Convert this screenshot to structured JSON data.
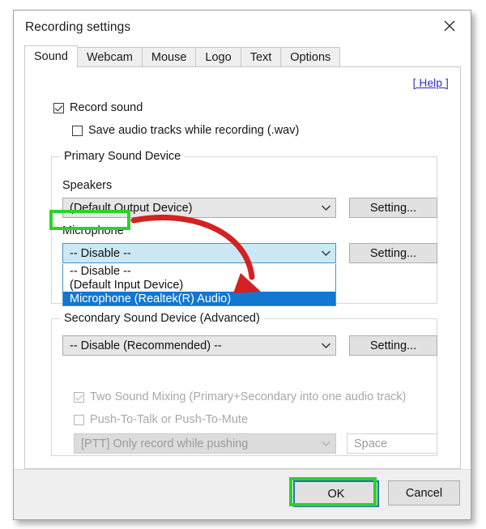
{
  "window": {
    "title": "Recording settings",
    "close_icon": "close-icon"
  },
  "tabs": [
    {
      "label": "Sound",
      "active": true
    },
    {
      "label": "Webcam",
      "active": false
    },
    {
      "label": "Mouse",
      "active": false
    },
    {
      "label": "Logo",
      "active": false
    },
    {
      "label": "Text",
      "active": false
    },
    {
      "label": "Options",
      "active": false
    }
  ],
  "content": {
    "record_sound": {
      "label": "Record sound",
      "checked": true
    },
    "save_audio_tracks": {
      "label": "Save audio tracks while recording (.wav)",
      "checked": false
    },
    "help_link": "[ Help ]",
    "primary_group": {
      "title": "Primary Sound Device",
      "speakers_label": "Speakers",
      "speakers_value": "(Default Output Device)",
      "speakers_setting_button": "Setting...",
      "microphone_label": "Microphone",
      "microphone_value": "-- Disable --",
      "microphone_setting_button": "Setting...",
      "microphone_options": [
        "-- Disable --",
        "(Default Input Device)",
        "Microphone (Realtek(R) Audio)"
      ],
      "microphone_selected_option": "Microphone (Realtek(R) Audio)"
    },
    "secondary_group": {
      "title": "Secondary Sound Device (Advanced)",
      "value": "-- Disable (Recommended) --",
      "setting_button": "Setting..."
    },
    "two_sound_mixing": {
      "label": "Two Sound Mixing (Primary+Secondary into one audio track)",
      "checked": true,
      "disabled": true
    },
    "push_to_talk": {
      "label": "Push-To-Talk or Push-To-Mute",
      "checked": false,
      "disabled": true
    },
    "ptt_mode_value": "[PTT] Only record while pushing",
    "ptt_key_value": "Space"
  },
  "footer": {
    "ok_label": "OK",
    "cancel_label": "Cancel"
  },
  "annotations": {
    "highlight_color": "#2ad32a",
    "arrow_color": "#d42121",
    "selection_color": "#1177d1",
    "focus_color": "#2a6ab5",
    "link_color": "#2b2bc8"
  }
}
